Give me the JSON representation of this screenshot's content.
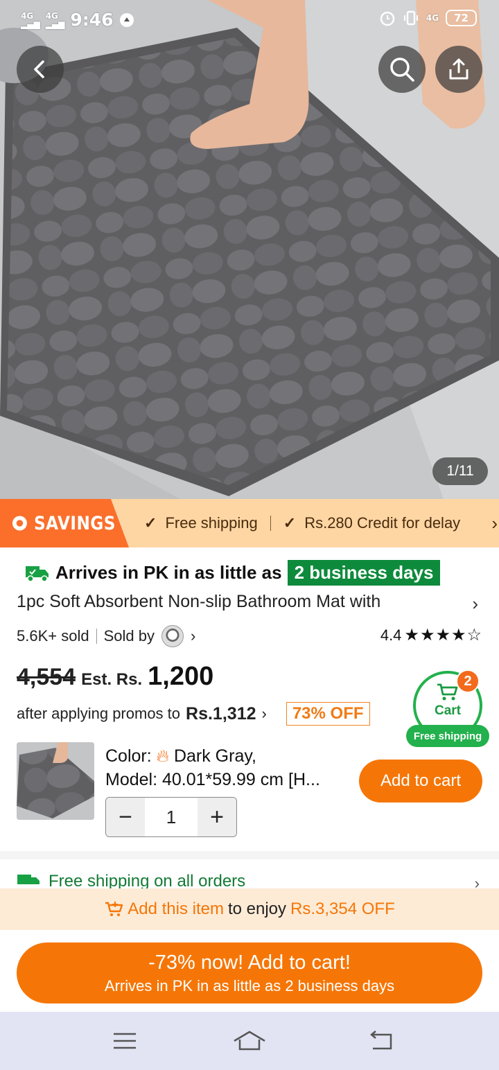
{
  "status_bar": {
    "time": "9:46",
    "network1": "4G",
    "network2": "4G",
    "network3": "4G",
    "battery": "72"
  },
  "gallery": {
    "counter": "1/11"
  },
  "savings_bar": {
    "tag": "SAVINGS",
    "item1": "Free shipping",
    "item2": "Rs.280 Credit for delay"
  },
  "product": {
    "arrival_prefix": "Arrives in PK in as little as",
    "arrival_days": "2 business days",
    "title": "1pc Soft Absorbent Non-slip Bathroom Mat with",
    "sold": "5.6K+ sold",
    "sold_by": "Sold by",
    "rating": "4.4",
    "stars": "★★★★☆",
    "old_price": "4,554",
    "est_label": "Est. Rs.",
    "price": "1,200",
    "promo_text": "after applying promos to",
    "promo_price": "Rs.1,312",
    "discount_badge": "73% OFF"
  },
  "cart_badge": {
    "count": "2",
    "label": "Cart",
    "free_shipping": "Free shipping"
  },
  "variant": {
    "color_label": "Color:",
    "color_value": "Dark Gray,",
    "model": "Model: 40.01*59.99 cm [H...",
    "quantity": "1",
    "add_to_cart": "Add to cart"
  },
  "shipping_row": {
    "text": "Free shipping on all orders"
  },
  "promo_bar": {
    "prefix": "Add this item",
    "middle": "to enjoy",
    "amount": "Rs.3,354 OFF"
  },
  "cta": {
    "line1": "-73% now! Add to cart!",
    "line2": "Arrives in PK in as little as 2 business days"
  },
  "colors": {
    "accent_orange": "#f57607",
    "savings_tag": "#fb6f2b",
    "green": "#0e8a3c"
  }
}
